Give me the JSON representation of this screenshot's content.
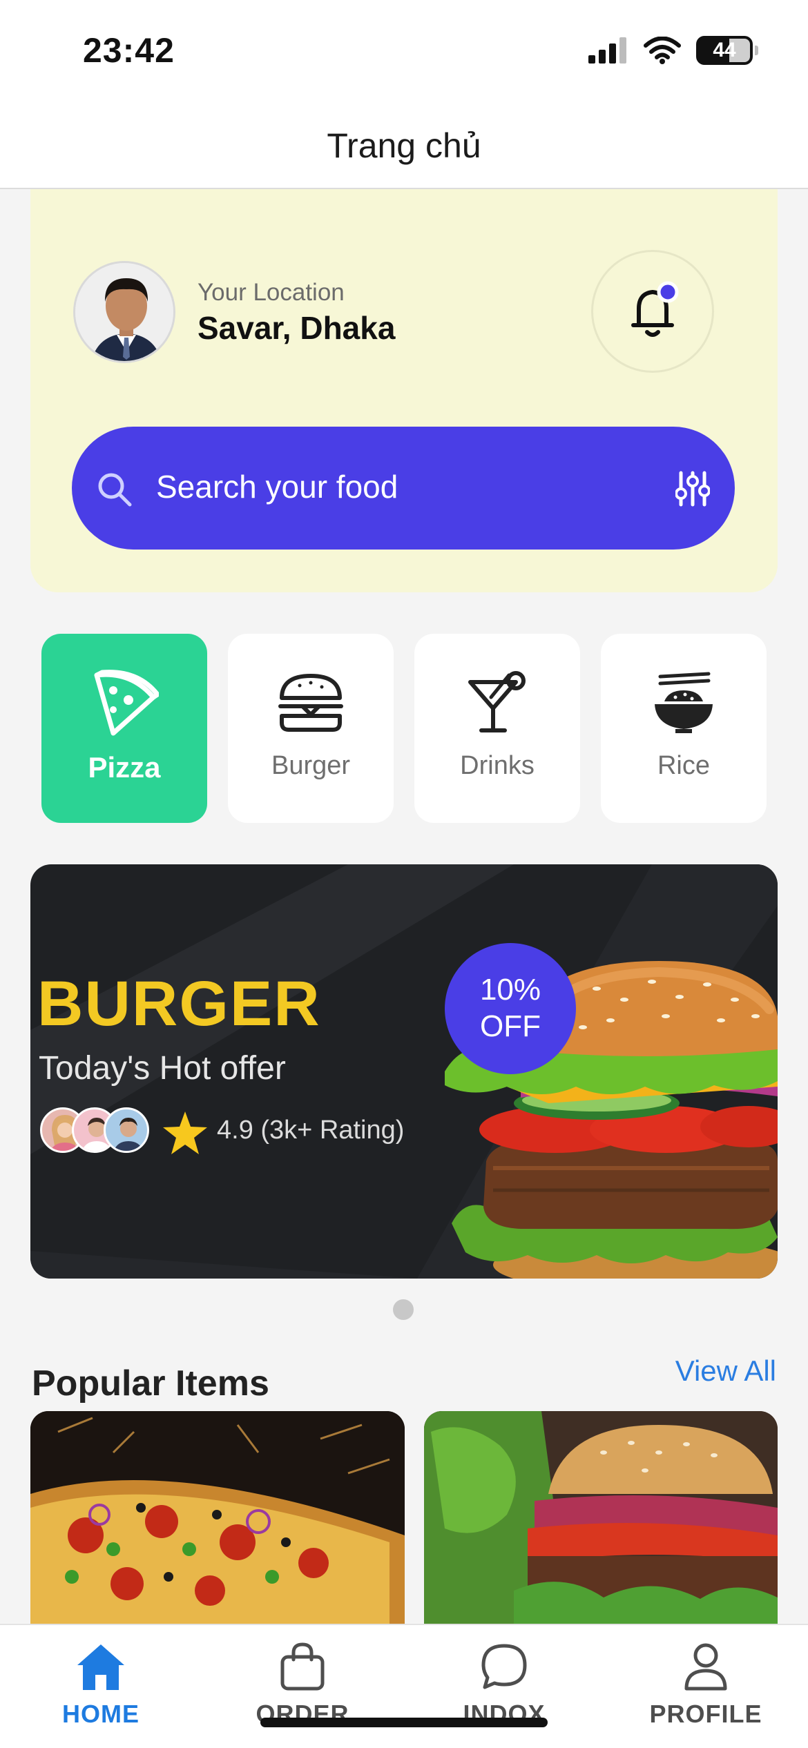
{
  "status_bar": {
    "time": "23:42",
    "battery": "44"
  },
  "header": {
    "title": "Trang chủ"
  },
  "location": {
    "label": "Your Location",
    "value": "Savar, Dhaka"
  },
  "search": {
    "placeholder": "Search your food"
  },
  "categories": [
    {
      "label": "Pizza",
      "icon": "pizza-icon",
      "active": true
    },
    {
      "label": "Burger",
      "icon": "burger-icon",
      "active": false
    },
    {
      "label": "Drinks",
      "icon": "cocktail-icon",
      "active": false
    },
    {
      "label": "Rice",
      "icon": "rice-bowl-icon",
      "active": false
    }
  ],
  "banner": {
    "title": "BURGER",
    "subtitle": "Today's Hot offer",
    "rating": "4.9 (3k+ Rating)",
    "discount_line1": "10%",
    "discount_line2": "OFF"
  },
  "popular": {
    "title": "Popular Items",
    "view_all": "View All"
  },
  "tabs": [
    {
      "label": "HOME",
      "icon": "home-icon",
      "active": true
    },
    {
      "label": "ORDER",
      "icon": "bag-icon",
      "active": false
    },
    {
      "label": "INDOX",
      "icon": "chat-icon",
      "active": false
    },
    {
      "label": "PROFILE",
      "icon": "user-icon",
      "active": false
    }
  ],
  "colors": {
    "accent": "#4a3ee6",
    "active_category": "#2bd394",
    "hero_background": "#f7f7d6",
    "banner_title": "#f3c923",
    "tab_active": "#1e7be0",
    "link": "#2a7de1"
  }
}
